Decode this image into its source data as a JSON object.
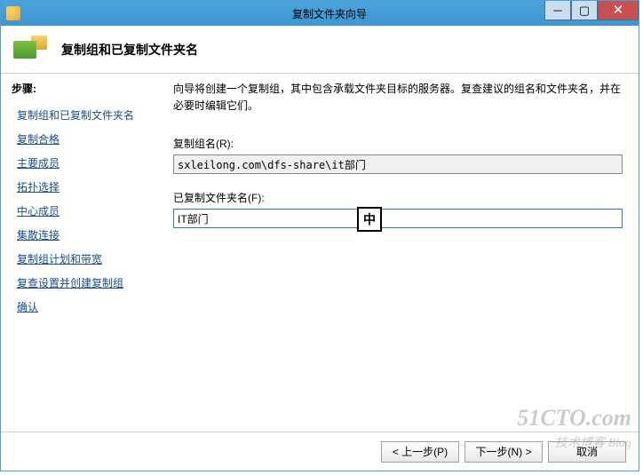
{
  "window": {
    "title": "复制文件夹向导"
  },
  "header": {
    "title": "复制组和已复制文件夹名"
  },
  "sidebar": {
    "label": "步骤:",
    "items": [
      {
        "label": "复制组和已复制文件夹名"
      },
      {
        "label": "复制合格"
      },
      {
        "label": "主要成员"
      },
      {
        "label": "拓扑选择"
      },
      {
        "label": "中心成员"
      },
      {
        "label": "集散连接"
      },
      {
        "label": "复制组计划和带宽"
      },
      {
        "label": "复查设置并创建复制组"
      },
      {
        "label": "确认"
      }
    ]
  },
  "main": {
    "description": "向导将创建一个复制组，其中包含承载文件夹目标的服务器。复查建议的组名和文件夹名，并在必要时编辑它们。",
    "group_label": "复制组名(R):",
    "group_value": "sxleilong.com\\dfs-share\\it部门",
    "folder_label": "已复制文件夹名(F):",
    "folder_value": "IT部门"
  },
  "ime": {
    "char": "中"
  },
  "footer": {
    "prev": "< 上一步(P)",
    "next": "下一步(N) >",
    "cancel": "取消"
  },
  "watermark": {
    "main": "51CTO.com",
    "sub": "技术博客 Blog"
  }
}
